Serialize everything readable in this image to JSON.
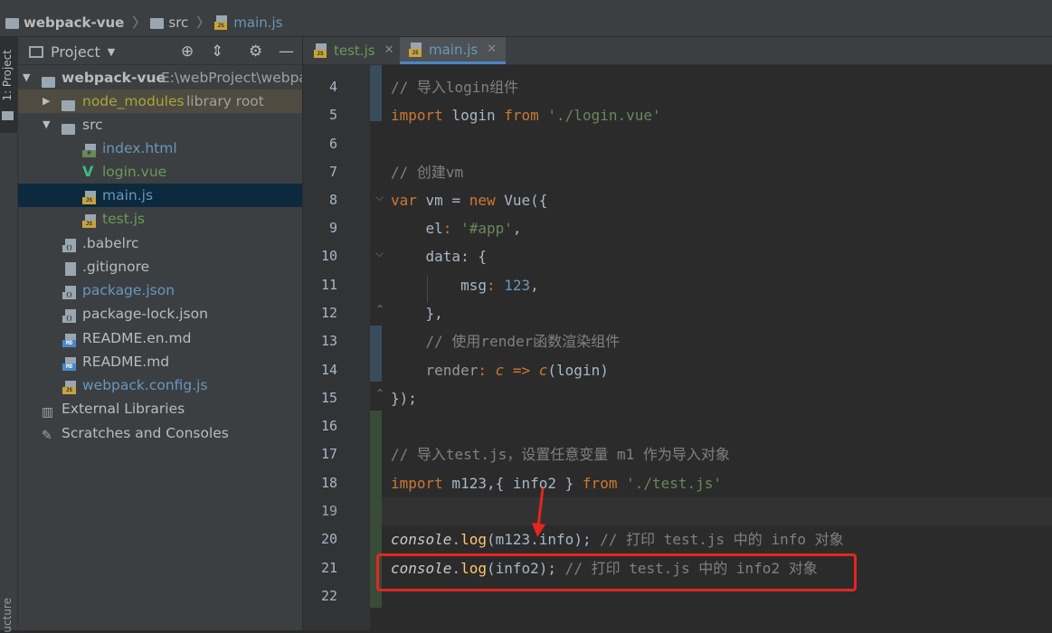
{
  "breadcrumb": {
    "project": "webpack-vue",
    "folder": "src",
    "file": "main.js"
  },
  "left_strip": {
    "project_tab": "1: Project",
    "structure_tab": "ucture"
  },
  "project_panel": {
    "title": "Project",
    "root_name": "webpack-vue",
    "root_path": "E:\\webProject\\webpa",
    "node_modules": "node_modules",
    "node_modules_note": "library root",
    "src": "src",
    "files": {
      "index_html": "index.html",
      "login_vue": "login.vue",
      "main_js": "main.js",
      "test_js": "test.js",
      "babelrc": ".babelrc",
      "gitignore": ".gitignore",
      "package_json": "package.json",
      "package_lock": "package-lock.json",
      "readme_en": "README.en.md",
      "readme": "README.md",
      "webpack_config": "webpack.config.js"
    },
    "external_libraries": "External Libraries",
    "scratches": "Scratches and Consoles"
  },
  "tabs": [
    {
      "label": "test.js",
      "active": false
    },
    {
      "label": "main.js",
      "active": true
    }
  ],
  "editor": {
    "current_line": 19,
    "lines": [
      {
        "n": "4"
      },
      {
        "n": "5"
      },
      {
        "n": "6"
      },
      {
        "n": "7"
      },
      {
        "n": "8"
      },
      {
        "n": "9"
      },
      {
        "n": "10"
      },
      {
        "n": "11"
      },
      {
        "n": "12"
      },
      {
        "n": "13"
      },
      {
        "n": "14"
      },
      {
        "n": "15"
      },
      {
        "n": "16"
      },
      {
        "n": "17"
      },
      {
        "n": "18"
      },
      {
        "n": "19"
      },
      {
        "n": "20"
      },
      {
        "n": "21"
      },
      {
        "n": "22"
      }
    ],
    "code": {
      "l4": "// 导入login组件",
      "l5_kw": "import",
      "l5_id": " login ",
      "l5_from": "from",
      "l5_str": "'./login.vue'",
      "l7": "// 创建vm",
      "l8_var": "var",
      "l8_vm": " vm = ",
      "l8_new": "new",
      "l8_rest": " Vue({",
      "l9_key": "el",
      "l9_colon": ": ",
      "l9_str": "'#app'",
      "l9_end": ",",
      "l10_key": "data",
      "l10_rest": ": {",
      "l11_key": "msg",
      "l11_colon": ": ",
      "l11_num": "123",
      "l11_end": ",",
      "l12": "},",
      "l13": "// 使用render函数渲染组件",
      "l14_key": "render",
      "l14_colon": ": ",
      "l14_c": "c",
      "l14_arrow": " => ",
      "l14_c2": "c",
      "l14_rest": "(login)",
      "l15": "});",
      "l17": "// 导入test.js，设置任意变量 m1 作为导入对象",
      "l18_kw": "import",
      "l18_id": " m123,{ info2 } ",
      "l18_from": "from",
      "l18_str": "'./test.js'",
      "l20_console": "console",
      "l20_dot": ".",
      "l20_log": "log",
      "l20_args": "(m123.info);",
      "l20_cmt": " // 打印 test.js 中的 info 对象",
      "l21_console": "console",
      "l21_dot": ".",
      "l21_log": "log",
      "l21_args": "(info2);",
      "l21_cmt": " // 打印 test.js 中的 info2 对象"
    }
  },
  "annotation": {
    "box_color": "#e5251f",
    "arrow_color": "#e5251f"
  }
}
